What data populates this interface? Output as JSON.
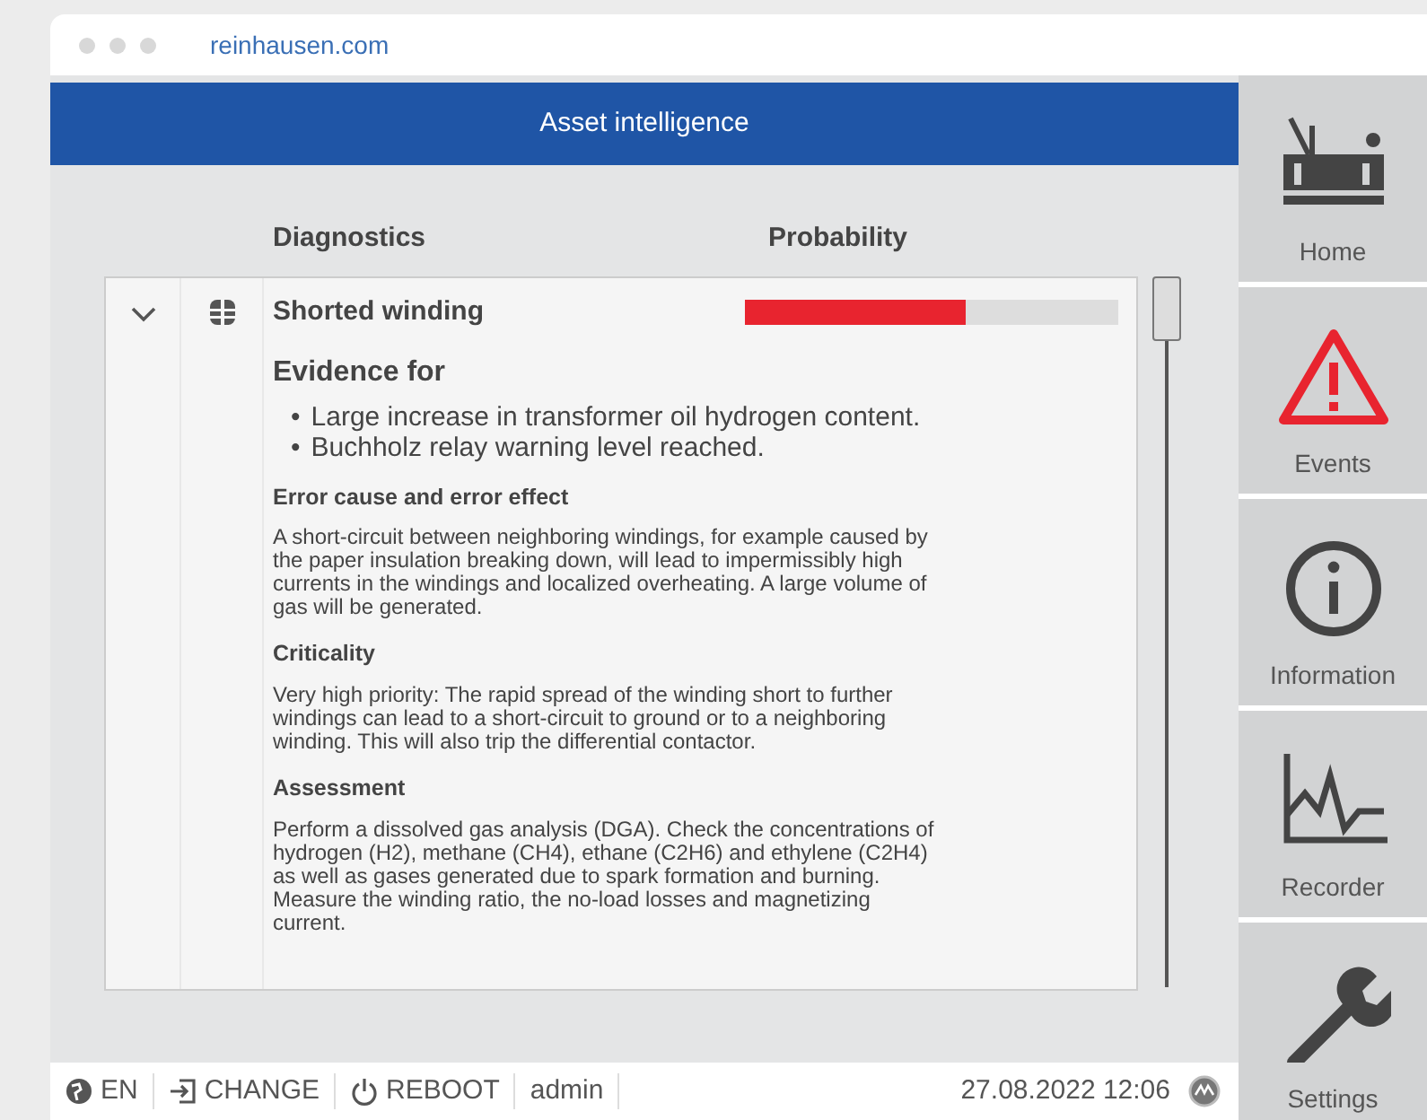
{
  "browser": {
    "url": "reinhausen.com"
  },
  "header": {
    "title": "Asset intelligence"
  },
  "columns": [
    "Diagnostics",
    "Probability"
  ],
  "diagnostics": [
    {
      "title": "Shorted winding",
      "expanded": true,
      "level": 0.59,
      "evidence_title": "Evidence for",
      "bullet": "•",
      "evidence": [
        "Large increase in transformer oil hydrogen content.",
        "Buchholz relay warning level reached."
      ],
      "sections": [
        {
          "heading": "Error cause and error effect",
          "text": "A short-circuit between neighboring windings, for example caused by the paper insulation breaking down, will lead to impermissibly high currents in the windings and localized overheating. A large volume of gas will be generated."
        },
        {
          "heading": "Criticality",
          "text": "Very high priority: The rapid spread of the winding short to further windings can lead to a short-circuit to ground or to a neighboring winding. This will also trip the differential contactor."
        },
        {
          "heading": "Assessment",
          "text": "Perform a dissolved gas analysis (DGA). Check the concentrations of hydrogen (H2), methane (CH4), ethane (C2H6) and ethylene (C2H4) as well as gases generated due to spark formation and burning. Measure the winding ratio, the no-load losses and magnetizing current."
        }
      ]
    }
  ],
  "status_bar": {
    "items": [
      {
        "kind": "language",
        "label": "EN"
      },
      {
        "kind": "change",
        "label": "CHANGE"
      },
      {
        "kind": "reboot",
        "label": "REBOOT"
      },
      {
        "kind": "user",
        "label": "admin"
      }
    ],
    "datetime": "27.08.2022 12:06"
  },
  "sidebar": {
    "items": [
      {
        "kind": "home",
        "label": "Home"
      },
      {
        "kind": "events",
        "label": "Events"
      },
      {
        "kind": "information",
        "label": "Information"
      },
      {
        "kind": "recorder",
        "label": "Recorder"
      },
      {
        "kind": "settings",
        "label": "Settings"
      }
    ]
  }
}
